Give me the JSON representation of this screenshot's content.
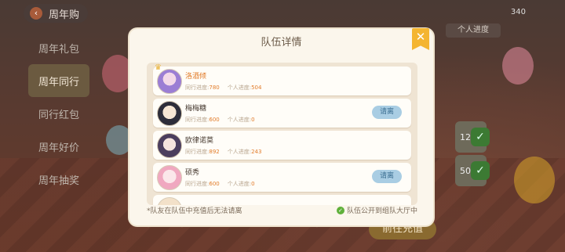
{
  "background": {
    "top_tab": "周年购",
    "sidebar": [
      "周年礼包",
      "周年同行",
      "同行红包",
      "周年好价",
      "周年抽奖"
    ],
    "active_sidebar_index": 1,
    "coin_count": "340",
    "right_tab": "个人进度",
    "card_values": [
      "12",
      "50"
    ],
    "go_button": "前往充值"
  },
  "modal": {
    "title": "队伍详情",
    "progress_label": "同行进度:",
    "personal_label": "个人进度:",
    "kick_label": "请离",
    "members": [
      {
        "name": "洛酒倾",
        "team_progress": "780",
        "personal_progress": "504",
        "captain": true,
        "kickable": false
      },
      {
        "name": "梅梅糖",
        "team_progress": "600",
        "personal_progress": "0",
        "captain": false,
        "kickable": true
      },
      {
        "name": "欧律诺莫",
        "team_progress": "892",
        "personal_progress": "243",
        "captain": false,
        "kickable": false
      },
      {
        "name": "硕秀",
        "team_progress": "600",
        "personal_progress": "0",
        "captain": false,
        "kickable": true
      }
    ],
    "footer_note": "*队友在队伍中充值后无法请离",
    "footer_check": "队伍公开到组队大厅中"
  },
  "colors": {
    "accent": "#e27c2a",
    "kick_button": "#a9cde3",
    "close_button": "#f4b531",
    "check": "#5fb03a"
  }
}
